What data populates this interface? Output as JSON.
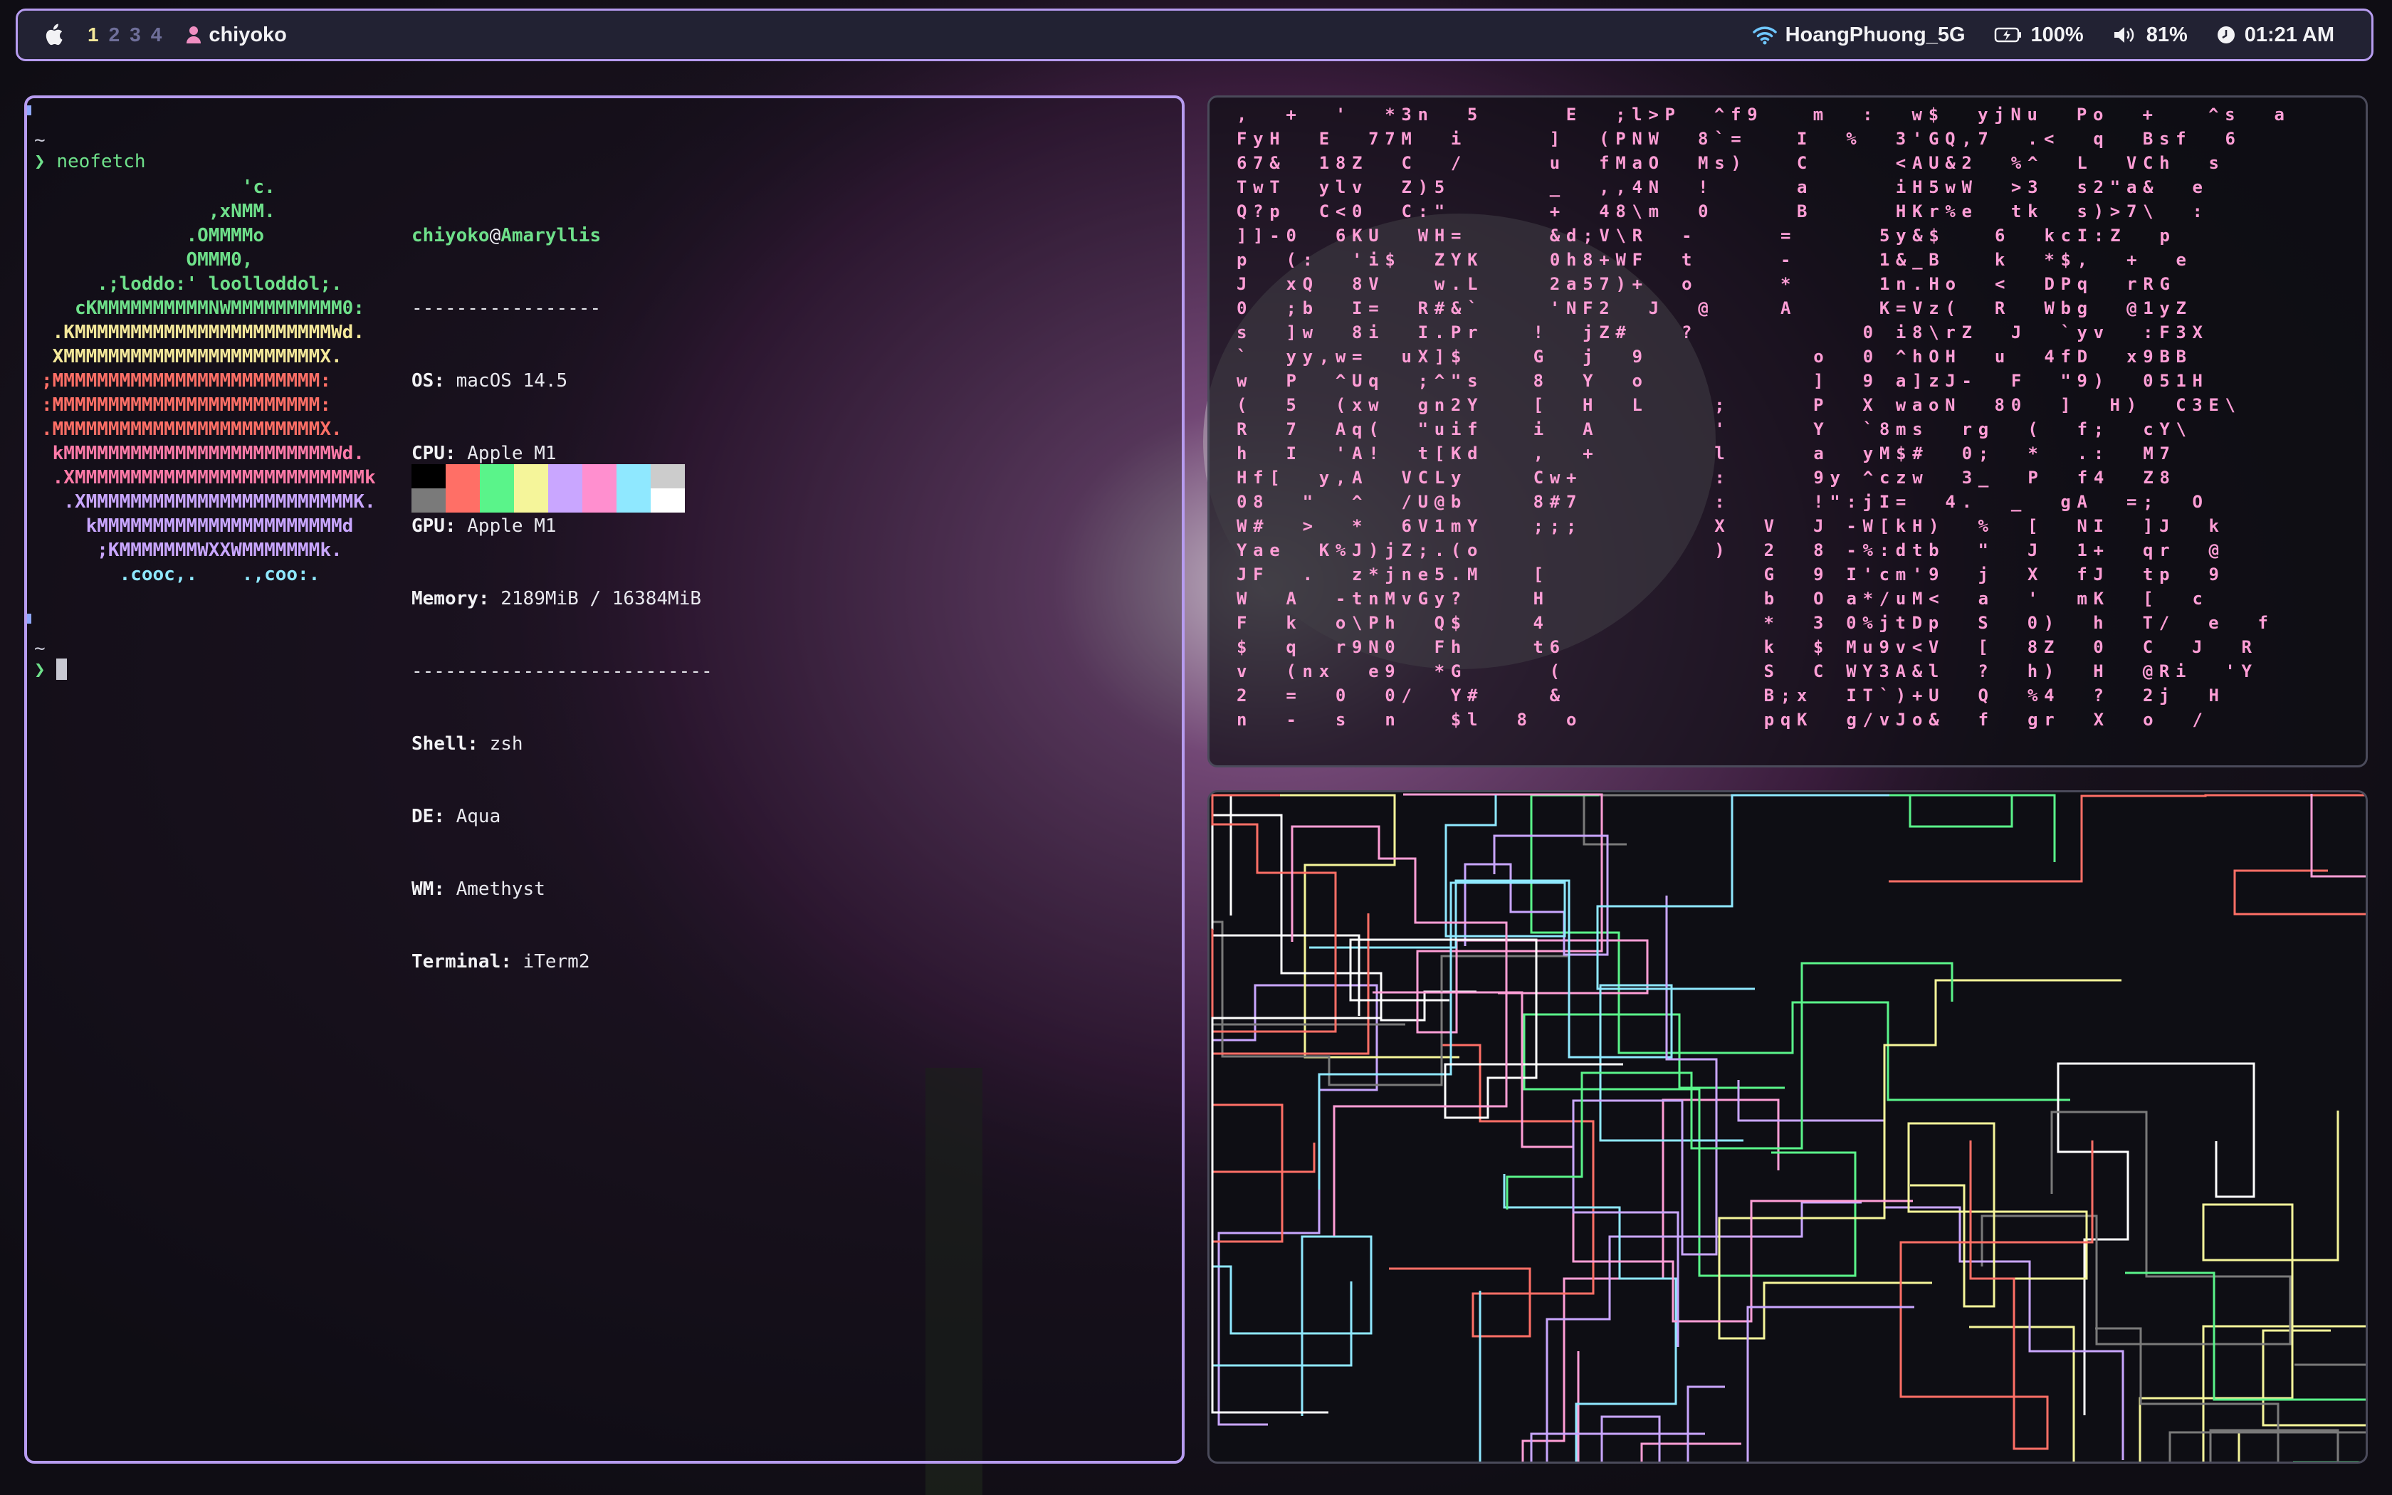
{
  "menubar": {
    "apple_icon": "apple-logo-icon",
    "workspaces": [
      "1",
      "2",
      "3",
      "4"
    ],
    "active_workspace": "1",
    "user": "chiyoko",
    "wifi": "HoangPhuong_5G",
    "battery": "100%",
    "volume": "81%",
    "time": "01:21 AM",
    "colors": {
      "accent": "#b79cf0",
      "active_ws": "#f5e99a",
      "inactive_ws": "#6f6f9a",
      "bar_bg": "#222233",
      "user_icon": "#f08fc2"
    }
  },
  "terminal": {
    "tilde": "~",
    "prompt": "❯",
    "command": "neofetch",
    "ascii_art": [
      "                  'c.",
      "               ,xNMM.",
      "             .OMMMMo",
      "             OMMM0,",
      "     .;loddo:' loolloddol;.",
      "   cKMMMMMMMMMMNWMMMMMMMMMM0:",
      " .KMMMMMMMMMMMMMMMMMMMMMMMWd.",
      " XMMMMMMMMMMMMMMMMMMMMMMMX.",
      ";MMMMMMMMMMMMMMMMMMMMMMMM:",
      ":MMMMMMMMMMMMMMMMMMMMMMMM:",
      ".MMMMMMMMMMMMMMMMMMMMMMMMX.",
      " kMMMMMMMMMMMMMMMMMMMMMMMMWd.",
      " .XMMMMMMMMMMMMMMMMMMMMMMMMMMk",
      "  .XMMMMMMMMMMMMMMMMMMMMMMMMK.",
      "    kMMMMMMMMMMMMMMMMMMMMMMd",
      "     ;KMMMMMMMWXXWMMMMMMMk.",
      "       .cooc,.    .,coo:."
    ],
    "ascii_colors": [
      "#6ee08a",
      "#6ee08a",
      "#6ee08a",
      "#6ee08a",
      "#6ee08a",
      "#6ee08a",
      "#f5e99a",
      "#f5e99a",
      "#ff6f66",
      "#ff6f66",
      "#ff6f66",
      "#ff7aa8",
      "#ff7aa8",
      "#c9a6ff",
      "#c9a6ff",
      "#c9a6ff",
      "#8fe8ff"
    ],
    "user": "chiyoko",
    "at": "@",
    "host": "Amaryllis",
    "separator_short": "-----------------",
    "separator_long": "---------------------------",
    "info": [
      {
        "key": "OS:",
        "value": "macOS 14.5"
      },
      {
        "key": "CPU:",
        "value": "Apple M1"
      },
      {
        "key": "GPU:",
        "value": "Apple M1"
      },
      {
        "key": "Memory:",
        "value": "2189MiB / 16384MiB"
      }
    ],
    "info2": [
      {
        "key": "Shell:",
        "value": "zsh"
      },
      {
        "key": "DE:",
        "value": "Aqua"
      },
      {
        "key": "WM:",
        "value": "Amethyst"
      },
      {
        "key": "Terminal:",
        "value": "iTerm2"
      }
    ],
    "palette": [
      "#000000",
      "#ff6f66",
      "#5af48a",
      "#f5f59a",
      "#c9a6ff",
      "#ff8fcf",
      "#8fe8ff",
      "#cccccc",
      "#7a7a7a",
      "#ff6f66",
      "#5af48a",
      "#f5f59a",
      "#c9a6ff",
      "#ff8fcf",
      "#8fe8ff",
      "#ffffff"
    ]
  },
  "matrix": {
    "rows": [
      ",  +  '  *3n  5     E  ;l>P  ^f9   m  :  w$  yjNu  Po  +   ^s  a",
      "FyH  E  77M  i     ]  (PNW  8`=   I  %  3'GQ,7  .<  q  Bsf  6",
      "67&  18Z  C  /     u  fMaO  Ms)   C     <AU&2  %^  L  VCh  s",
      "TwT  ylv  Z)5      _  ,,4N  !     a     iH5wW  >3  s2\"a&  e",
      "Q?p  C<0  C:\"      +  48\\m  0     B     HKr%e  tk  s)>7\\  :",
      "]]-0  6KU  WH=     &d;V\\R  -     =     5y&$   6  kcI:Z  p",
      "p  (:  'i$  ZYK    0h8+WF  t     -     1&_B   k  *$,  +  e",
      "J  xQ  8V   w.L    2a57)+  o     *     1n.Ho  <  DPq  rRG",
      "0  ;b  I=  R#&`    'NF2  J  @    A     K=Vz(  R  Wbg  @1yZ",
      "s  ]w  8i  I.Pr   !  jZ#   ?          0 i8\\rZ  J  `yv  :F3X",
      "`  yy,w=  uX]$    G  j  9          o  0 ^hOH  u  4fD  x9BB",
      "w  P  ^Uq  ;^\"s   8  Y  o          ]  9 a]zJ-  F  \"9)  051H",
      "(  5  (xw  gn2Y   [  H  L    ;     P  X waoN  80  ]  H)  C3E\\",
      "R  7  Aq(  \"uif   i  A       '     Y  `8ms  rg  (  f;  cY\\",
      "h  I  'A!  t[Kd   ,  +       l     a  yM$#  0;  *  .:  M7",
      "Hf[  y,A  VCLy    Cw+        :     9y ^czw  3_  P  f4  Z8",
      "08  \"  ^  /U@b    8#7        :     !\":jI=  4.  _  gA  =;  O",
      "W#  >  *  6V1mY   ;;;        X  V  J -W[kH)  %  [  NI  ]J  k",
      "Yae  K%J)jZ;.(o              )  2  8 -%:dtb  \"  J  1+  qr  @",
      "JF  .  z*jne5.M   [             G  9 I'cm'9  j  X  fJ  tp  9",
      "W  A  -tnMvGy?    H             b  O a*/uM<  a  '  mK  [  c",
      "F  k  o\\Ph  Q$    4             *  3 0%jtDp  S  0)  h  T/  e  f",
      "$  q  r9N0  Fh    t6            k  $ Mu9v<V  [  8Z  0  C  J  R",
      "v  (nx  e9  *G     (            S  C WY3A&l  ?  h)  H  @Ri  'Y",
      "2  =  0  0/  Y#    &            B;x  IT`)+U  Q  %4  ?  2j  H",
      "n  -  s  n   $l  8  o           pqK  g/vJo&  f  gr  X  o  /"
    ],
    "colors": [
      "#ff9ed6",
      "#ffffff",
      "#f2f2f5"
    ]
  },
  "pipes": {
    "colors": [
      "#ff9ed6",
      "#c9a6ff",
      "#8fe8ff",
      "#5af48a",
      "#f5f59a",
      "#ff6f66",
      "#ffffff",
      "#7a7a7a"
    ]
  }
}
